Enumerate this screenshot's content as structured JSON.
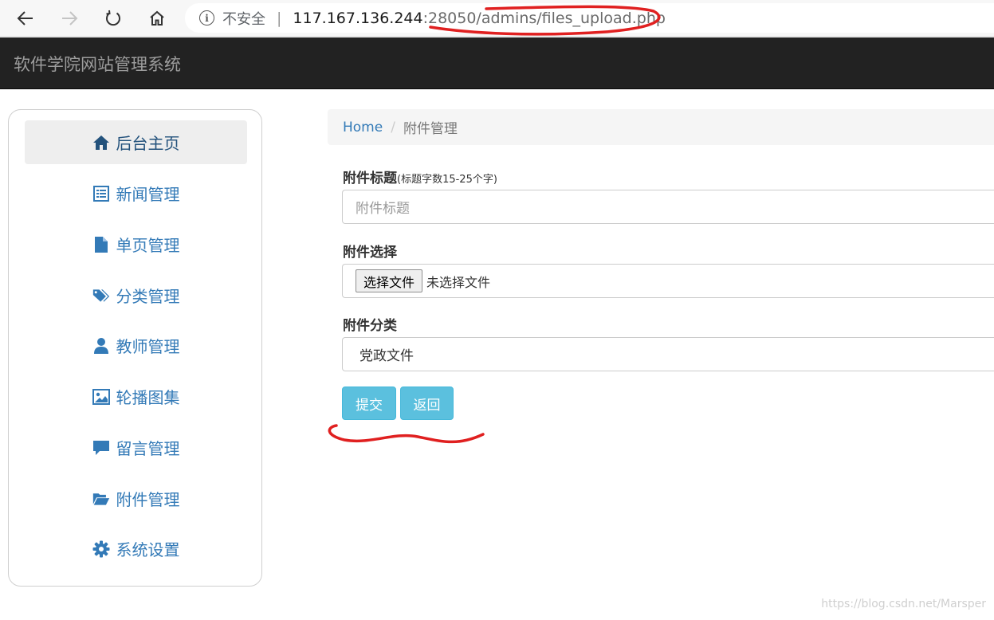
{
  "browser": {
    "security_label": "不安全",
    "separator": "|",
    "url_host": "117.167.136.244",
    "url_path": ":28050/admins/files_upload.php",
    "icons": [
      "back-arrow-icon",
      "forward-arrow-icon",
      "reload-icon",
      "home-icon",
      "info-icon"
    ]
  },
  "navbar": {
    "brand": "软件学院网站管理系统"
  },
  "sidebar": {
    "items": [
      {
        "label": "后台主页",
        "icon": "home-icon",
        "active": true
      },
      {
        "label": "新闻管理",
        "icon": "list-alt-icon"
      },
      {
        "label": "单页管理",
        "icon": "file-icon"
      },
      {
        "label": "分类管理",
        "icon": "tags-icon"
      },
      {
        "label": "教师管理",
        "icon": "user-icon"
      },
      {
        "label": "轮播图集",
        "icon": "picture-icon"
      },
      {
        "label": "留言管理",
        "icon": "comment-icon"
      },
      {
        "label": "附件管理",
        "icon": "folder-open-icon"
      },
      {
        "label": "系统设置",
        "icon": "cog-icon"
      }
    ]
  },
  "breadcrumb": {
    "home": "Home",
    "separator": "/",
    "current": "附件管理"
  },
  "form": {
    "title_label": "附件标题",
    "title_hint": "(标题字数15-25个字)",
    "title_placeholder": "附件标题",
    "file_label": "附件选择",
    "file_button": "选择文件",
    "file_status": "未选择文件",
    "category_label": "附件分类",
    "category_value": "党政文件"
  },
  "buttons": {
    "submit": "提交",
    "back": "返回"
  },
  "watermark": "https://blog.csdn.net/Marsper",
  "colors": {
    "link": "#337ab7",
    "info_button": "#5bc0de",
    "navbar": "#222222",
    "annotation": "#e02020"
  }
}
